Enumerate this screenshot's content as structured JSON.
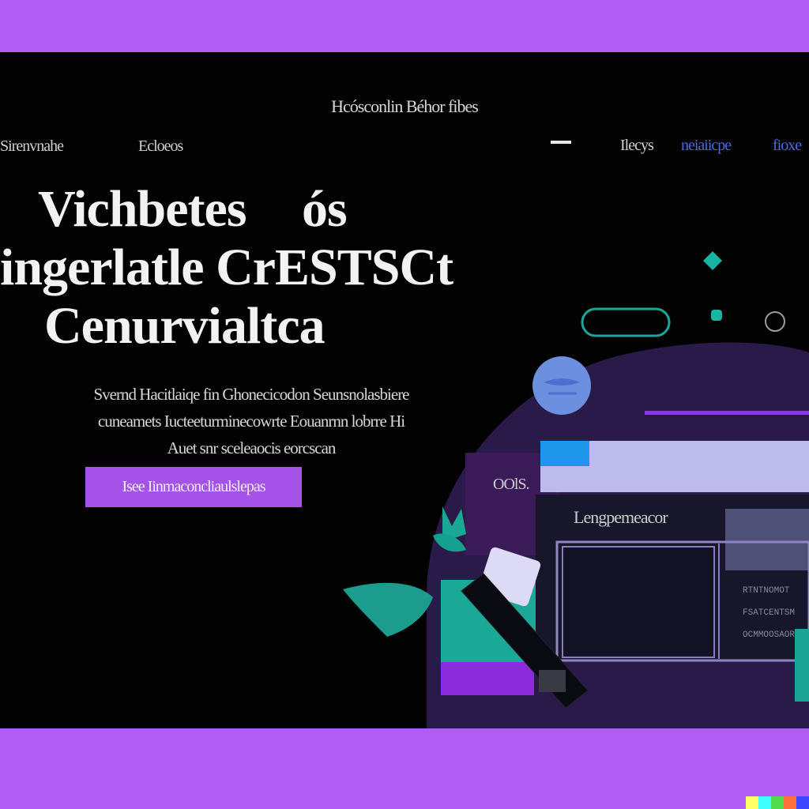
{
  "header": {
    "brand": "Hcósconlin Béhor fibes"
  },
  "nav": {
    "left_items": [
      "Sirenvnahe",
      "Ecloeos"
    ],
    "right_items": [
      "Ilecys",
      "neiaiicpe"
    ],
    "right_extra": "fioxe"
  },
  "hero": {
    "headline_lines": [
      "Vichbetes",
      "ingerlatle CrESTSCt",
      "Cenurvialtca"
    ],
    "headline_suffix": "ós",
    "description_lines": [
      "Svernd Hacitlaiqe fin Ghonecicodon Seunsnolasbiere",
      "cuneamets Iucteeturminecowrte Eouanrnn lobrre Hi",
      "Auet snr sceleaocis eorcscan"
    ],
    "cta_label": "Isee Iinmaconcliaulslepas"
  },
  "illustration": {
    "side_label": "OOlS.",
    "window_title": "Lengpemeacor",
    "mini_lines": [
      "RTNTNOMOT",
      "FSATCENTSM",
      "OCMMOOSAOR"
    ]
  },
  "colors": {
    "accent_purple": "#a552e8",
    "teal": "#1aa898",
    "background": "#020203",
    "frame_border": "#b25cf6"
  },
  "icons": [
    "diamond-icon",
    "pill-outline-icon",
    "teal-dot-icon",
    "ring-icon",
    "globe-icon",
    "leaf-icon",
    "pen-icon"
  ]
}
